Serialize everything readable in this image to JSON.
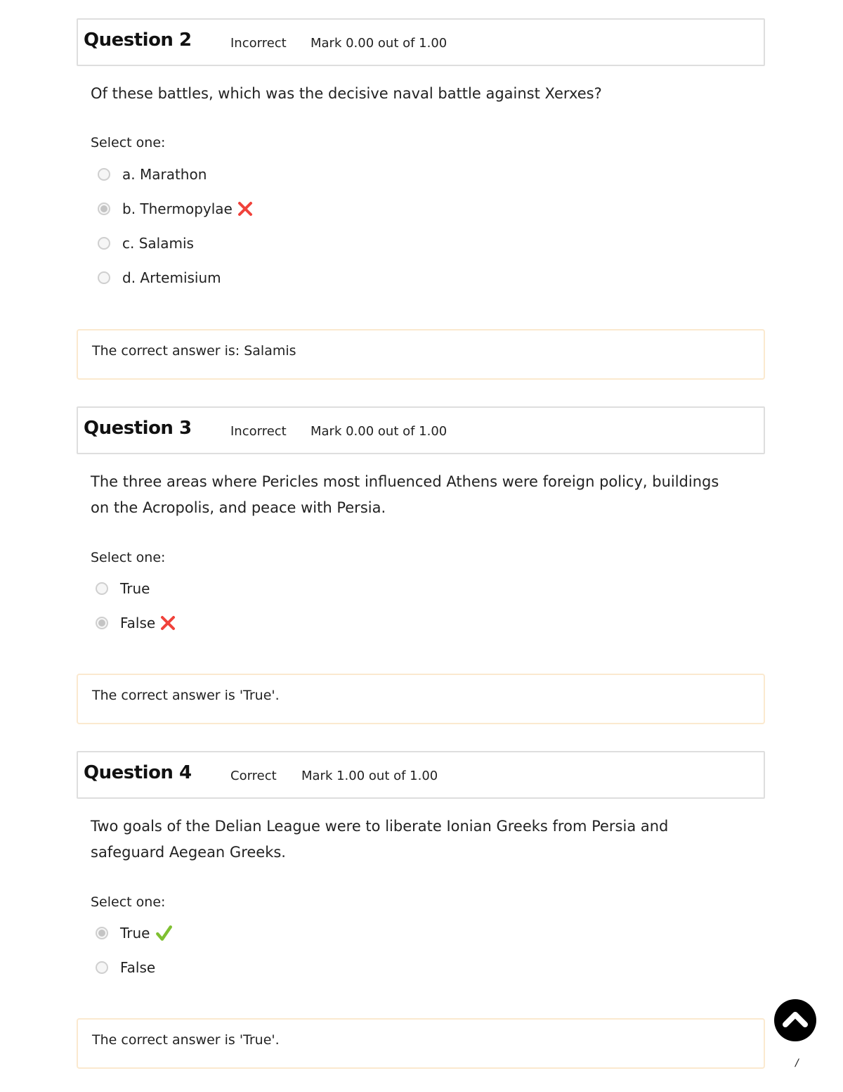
{
  "questions": [
    {
      "title": "Question 2",
      "state": "Incorrect",
      "mark": "Mark 0.00 out of 1.00",
      "text": "Of these battles, which was the decisive naval battle against Xerxes?",
      "prompt": "Select one:",
      "options": [
        {
          "label": "a. Marathon",
          "selected": false,
          "result": ""
        },
        {
          "label": "b. Thermopylae",
          "selected": true,
          "result": "incorrect-icon"
        },
        {
          "label": "c. Salamis",
          "selected": false,
          "result": ""
        },
        {
          "label": "d. Artemisium",
          "selected": false,
          "result": ""
        }
      ],
      "feedback": "The correct answer is: Salamis"
    },
    {
      "title": "Question 3",
      "state": "Incorrect",
      "mark": "Mark 0.00 out of 1.00",
      "text_lines": [
        "The three areas where Pericles most influenced Athens were foreign policy, buildings",
        "on the Acropolis, and peace with Persia."
      ],
      "prompt": "Select one:",
      "options": [
        {
          "label": "True",
          "selected": false,
          "result": ""
        },
        {
          "label": "False",
          "selected": true,
          "result": "incorrect-icon"
        }
      ],
      "feedback": "The correct answer is 'True'."
    },
    {
      "title": "Question 4",
      "state": "Correct",
      "mark": "Mark 1.00 out of 1.00",
      "text_lines": [
        "Two goals of the Delian League were to liberate Ionian Greeks from Persia and",
        "safeguard Aegean Greeks."
      ],
      "prompt": "Select one:",
      "options": [
        {
          "label": "True",
          "selected": true,
          "result": "correct-icon"
        },
        {
          "label": "False",
          "selected": false,
          "result": ""
        }
      ],
      "feedback": "The correct answer is 'True'."
    }
  ],
  "colors": {
    "incorrect": "#f0423b",
    "correct": "#7fc031",
    "feedback_border": "#fbe9cf"
  },
  "scroll_top_icon": "chevron-up-icon",
  "page_number": "/"
}
